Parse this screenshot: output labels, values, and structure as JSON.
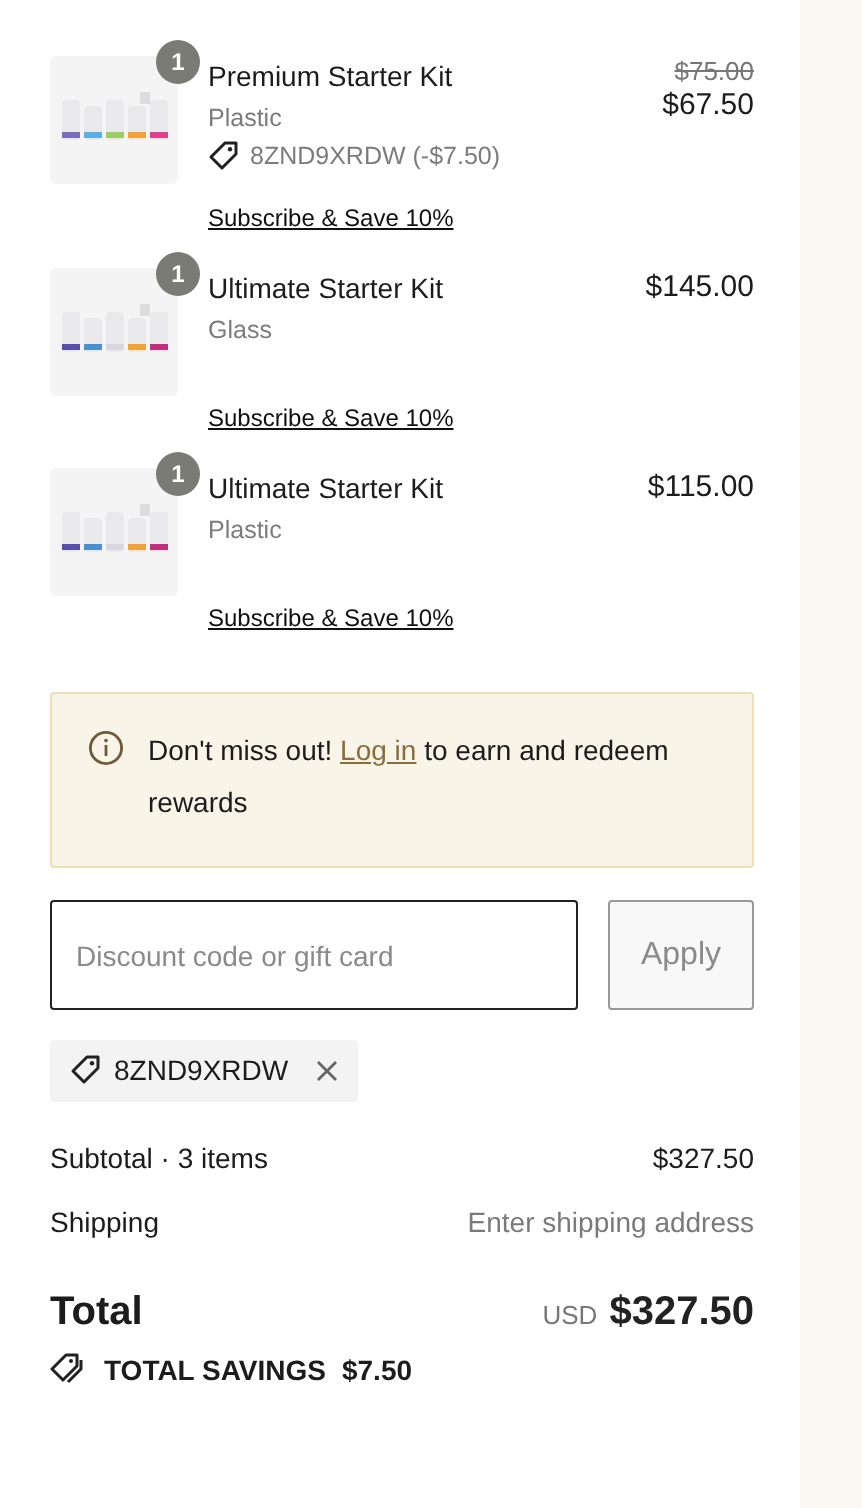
{
  "items": [
    {
      "quantity": "1",
      "name": "Premium Starter Kit",
      "variant": "Plastic",
      "discount": "8ZND9XRDW (-$7.50)",
      "original_price": "$75.00",
      "price": "$67.50",
      "subscribe": "Subscribe & Save 10%"
    },
    {
      "quantity": "1",
      "name": "Ultimate Starter Kit",
      "variant": "Glass",
      "price": "$145.00",
      "subscribe": "Subscribe & Save 10%"
    },
    {
      "quantity": "1",
      "name": "Ultimate Starter Kit",
      "variant": "Plastic",
      "price": "$115.00",
      "subscribe": "Subscribe & Save 10%"
    }
  ],
  "rewards_notice": {
    "before": "Don't miss out! ",
    "link": "Log in",
    "after": " to earn and redeem rewards"
  },
  "discount": {
    "placeholder": "Discount code or gift card",
    "button": "Apply",
    "disabled": true
  },
  "applied_codes": [
    {
      "code": "8ZND9XRDW"
    }
  ],
  "summary": [
    {
      "label": "Subtotal · 3 items",
      "value": "$327.50",
      "kind": "amount"
    },
    {
      "label": "Shipping",
      "value": "Enter shipping address",
      "kind": "hint"
    }
  ],
  "total": {
    "label": "Total",
    "currency": "USD",
    "value": "$327.50"
  },
  "savings": {
    "label": "TOTAL SAVINGS",
    "value": "$7.50"
  }
}
